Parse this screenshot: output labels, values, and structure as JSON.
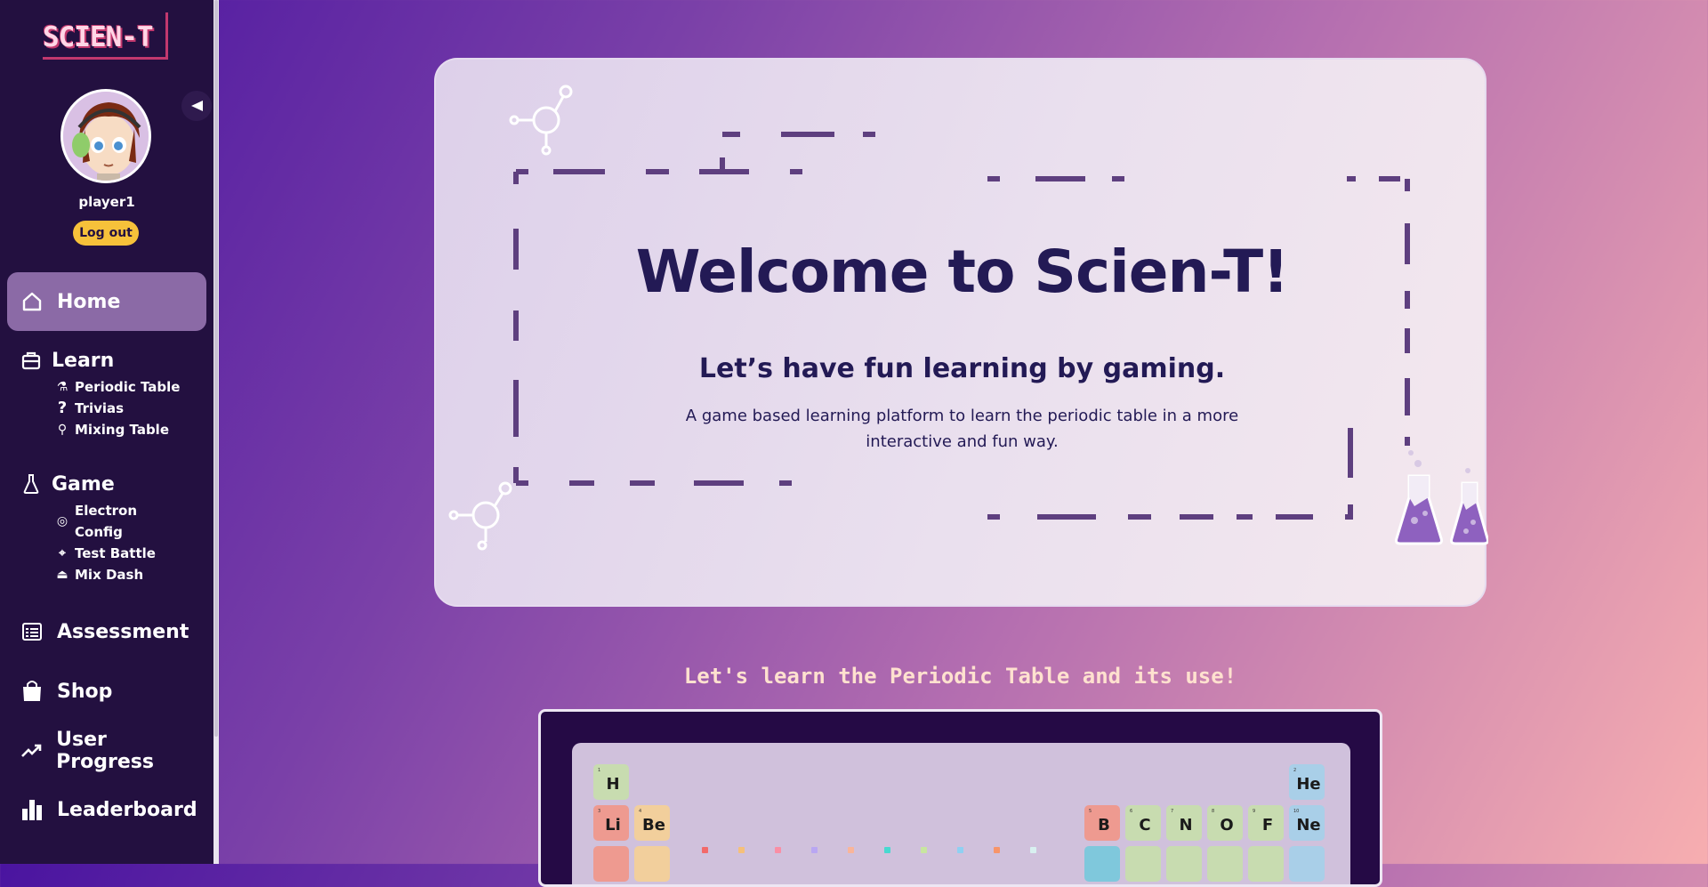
{
  "app": {
    "logo_text": "SCIEN-T"
  },
  "user": {
    "username": "player1",
    "logout_label": "Log out"
  },
  "sidebar": {
    "home_label": "Home",
    "learn": {
      "title": "Learn",
      "items": [
        {
          "label": "Periodic Table",
          "icon": "flask-icon"
        },
        {
          "label": "Trivias",
          "icon": "question-icon"
        },
        {
          "label": "Mixing Table",
          "icon": "microscope-icon"
        }
      ]
    },
    "game": {
      "title": "Game",
      "items": [
        {
          "label": "Electron\nConfig",
          "icon": "target-icon"
        },
        {
          "label": "Test Battle",
          "icon": "crosshair-icon"
        },
        {
          "label": "Mix Dash",
          "icon": "bell-icon"
        }
      ]
    },
    "assessment_label": "Assessment",
    "shop_label": "Shop",
    "progress_label": "User Progress",
    "leaderboard_label": "Leaderboard"
  },
  "hero": {
    "title": "Welcome to Scien-T!",
    "subtitle": "Let’s have fun learning by gaming.",
    "description": "A game based learning platform to learn the periodic table in a more interactive and fun way."
  },
  "periodic_section": {
    "heading": "Let's learn the Periodic Table and its use!",
    "elements": [
      {
        "symbol": "H",
        "number": "1",
        "color": "#c8dcb0"
      },
      {
        "symbol": "Li",
        "number": "3",
        "color": "#ee9a90"
      },
      {
        "symbol": "Be",
        "number": "4",
        "color": "#f2cf9c"
      },
      {
        "symbol": "B",
        "number": "5",
        "color": "#ee9a90"
      },
      {
        "symbol": "C",
        "number": "6",
        "color": "#c8dcb0"
      },
      {
        "symbol": "N",
        "number": "7",
        "color": "#c8dcb0"
      },
      {
        "symbol": "O",
        "number": "8",
        "color": "#c8dcb0"
      },
      {
        "symbol": "F",
        "number": "9",
        "color": "#c8dcb0"
      },
      {
        "symbol": "He",
        "number": "2",
        "color": "#a9cfe8"
      },
      {
        "symbol": "Ne",
        "number": "10",
        "color": "#a9cfe8"
      }
    ],
    "legend_colors": [
      "#f26a6a",
      "#f5c07a",
      "#f98fa5",
      "#b9a7f2",
      "#f9b59a",
      "#48d9d0",
      "#c8e6a0",
      "#8fd0f2",
      "#f7956a",
      "#d8f0f0"
    ]
  },
  "colors": {
    "sidebar_bg": "#231040",
    "accent_yellow": "#f7c13a",
    "title_navy": "#231a55",
    "active_nav": "#8b6aa6"
  }
}
